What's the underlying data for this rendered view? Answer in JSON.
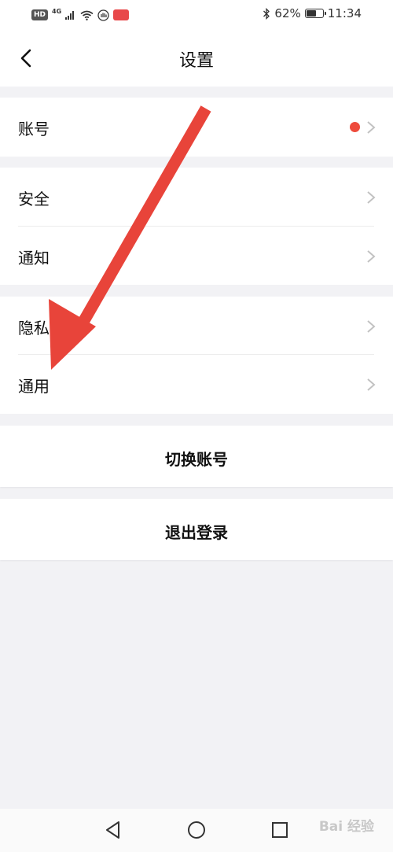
{
  "status_bar": {
    "hd": "HD",
    "network": "4G",
    "battery": "62%",
    "battery_level": 0.62,
    "time": "11:34",
    "icons": [
      "signal-icon",
      "wifi-icon",
      "hand-icon",
      "app-badge-icon",
      "bluetooth-icon",
      "battery-icon"
    ]
  },
  "header": {
    "title": "设置",
    "back_icon": "back-arrow-icon"
  },
  "groups": {
    "account": {
      "label": "账号",
      "badge_color": "#ee4b3c"
    },
    "security": {
      "label": "安全"
    },
    "notify": {
      "label": "通知"
    },
    "privacy": {
      "label": "隐私"
    },
    "general": {
      "label": "通用"
    }
  },
  "actions": {
    "switch_account": "切换账号",
    "logout": "退出登录"
  },
  "annotation": {
    "color": "#e8443a",
    "icon": "red-arrow-annotation"
  },
  "system_nav": {
    "icons": [
      "back-triangle-icon",
      "home-circle-icon",
      "recents-square-icon"
    ]
  },
  "watermark": "Bai 经验"
}
